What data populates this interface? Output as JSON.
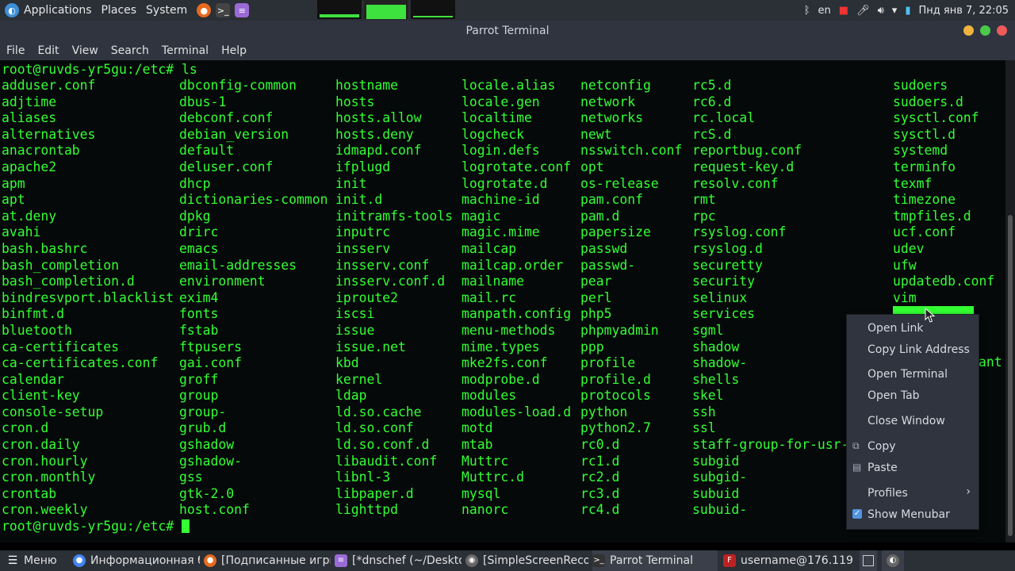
{
  "top_panel": {
    "applications": "Applications",
    "places": "Places",
    "system": "System",
    "clock": "Пнд янв  7, 22:05",
    "keyboard_layout": "en"
  },
  "window": {
    "title": "Parrot Terminal"
  },
  "menubar": [
    "File",
    "Edit",
    "View",
    "Search",
    "Terminal",
    "Help"
  ],
  "terminal": {
    "prompt": "root@ruvds-yr5gu:/etc# ",
    "command": "ls",
    "columns": [
      [
        "adduser.conf",
        "adjtime",
        "aliases",
        "alternatives",
        "anacrontab",
        "apache2",
        "apm",
        "apt",
        "at.deny",
        "avahi",
        "bash.bashrc",
        "bash_completion",
        "bash_completion.d",
        "bindresvport.blacklist",
        "binfmt.d",
        "bluetooth",
        "ca-certificates",
        "ca-certificates.conf",
        "calendar",
        "client-key",
        "console-setup",
        "cron.d",
        "cron.daily",
        "cron.hourly",
        "cron.monthly",
        "crontab",
        "cron.weekly"
      ],
      [
        "dbconfig-common",
        "dbus-1",
        "debconf.conf",
        "debian_version",
        "default",
        "deluser.conf",
        "dhcp",
        "dictionaries-common",
        "dpkg",
        "drirc",
        "emacs",
        "email-addresses",
        "environment",
        "exim4",
        "fonts",
        "fstab",
        "ftpusers",
        "gai.conf",
        "groff",
        "group",
        "group-",
        "grub.d",
        "gshadow",
        "gshadow-",
        "gss",
        "gtk-2.0",
        "host.conf"
      ],
      [
        "hostname",
        "hosts",
        "hosts.allow",
        "hosts.deny",
        "idmapd.conf",
        "ifplugd",
        "init",
        "init.d",
        "initramfs-tools",
        "inputrc",
        "insserv",
        "insserv.conf",
        "insserv.conf.d",
        "iproute2",
        "iscsi",
        "issue",
        "issue.net",
        "kbd",
        "kernel",
        "ldap",
        "ld.so.cache",
        "ld.so.conf",
        "ld.so.conf.d",
        "libaudit.conf",
        "libnl-3",
        "libpaper.d",
        "lighttpd"
      ],
      [
        "locale.alias",
        "locale.gen",
        "localtime",
        "logcheck",
        "login.defs",
        "logrotate.conf",
        "logrotate.d",
        "machine-id",
        "magic",
        "magic.mime",
        "mailcap",
        "mailcap.order",
        "mailname",
        "mail.rc",
        "manpath.config",
        "menu-methods",
        "mime.types",
        "mke2fs.conf",
        "modprobe.d",
        "modules",
        "modules-load.d",
        "motd",
        "mtab",
        "Muttrc",
        "Muttrc.d",
        "mysql",
        "nanorc"
      ],
      [
        "netconfig",
        "network",
        "networks",
        "newt",
        "nsswitch.conf",
        "opt",
        "os-release",
        "pam.conf",
        "pam.d",
        "papersize",
        "passwd",
        "passwd-",
        "pear",
        "perl",
        "php5",
        "phpmyadmin",
        "ppp",
        "profile",
        "profile.d",
        "protocols",
        "python",
        "python2.7",
        "rc0.d",
        "rc1.d",
        "rc2.d",
        "rc3.d",
        "rc4.d"
      ],
      [
        "rc5.d",
        "rc6.d",
        "rc.local",
        "rcS.d",
        "reportbug.conf",
        "request-key.d",
        "resolv.conf",
        "rmt",
        "rpc",
        "rsyslog.conf",
        "rsyslog.d",
        "securetty",
        "security",
        "selinux",
        "services",
        "sgml",
        "shadow",
        "shadow-",
        "shells",
        "skel",
        "ssh",
        "ssl",
        "staff-group-for-usr-l",
        "subgid",
        "subgid-",
        "subuid",
        "subuid-"
      ],
      [
        "sudoers",
        "sudoers.d",
        "sysctl.conf",
        "sysctl.d",
        "systemd",
        "terminfo",
        "texmf",
        "timezone",
        "tmpfiles.d",
        "ucf.conf",
        "udev",
        "ufw",
        "updatedb.conf",
        "vim",
        "",
        "",
        "",
        "",
        "",
        "",
        "",
        "",
        "",
        "",
        "",
        "",
        ""
      ]
    ],
    "partial_text": "ant"
  },
  "context_menu": {
    "items": {
      "open_link": "Open Link",
      "copy_link": "Copy Link Address",
      "open_terminal": "Open Terminal",
      "open_tab": "Open Tab",
      "close_window": "Close Window",
      "copy": "Copy",
      "paste": "Paste",
      "profiles": "Profiles",
      "show_menubar": "Show Menubar"
    }
  },
  "taskbar": {
    "menu": "Меню",
    "tasks": [
      "Информационная б...",
      "[Подписанные игры...",
      "[*dnschef (~/Deskto...",
      "[SimpleScreenReco...",
      "Parrot Terminal",
      "username@176.119...."
    ]
  },
  "colors": {
    "terminal_fg": "#33ff33",
    "terminal_bg": "#06090a",
    "panel_bg": "#2b2f36",
    "menu_bg": "#2f343f"
  }
}
